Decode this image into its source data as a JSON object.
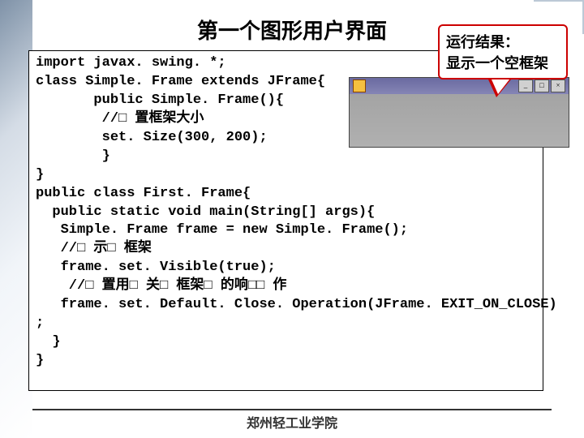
{
  "title": "第一个图形用户界面",
  "callout_line1": "运行结果：",
  "callout_line2": "显示一个空框架",
  "code_lines": [
    "import javax. swing. *;",
    "class Simple. Frame extends JFrame{",
    "       public Simple. Frame(){",
    "        //□ 置框架大小",
    "        set. Size(300, 200);",
    "        }",
    "}",
    "public class First. Frame{",
    "  public static void main(String[] args){",
    "   Simple. Frame frame = new Simple. Frame();",
    "   //□ 示□ 框架",
    "   frame. set. Visible(true);",
    "    //□ 置用□ 关□ 框架□ 的响□□ 作",
    "   frame. set. Default. Close. Operation(JFrame. EXIT_ON_CLOSE)",
    ";",
    "  }",
    "}"
  ],
  "footer": "郑州轻工业学院",
  "win_min": "_",
  "win_max": "□",
  "win_close": "×"
}
